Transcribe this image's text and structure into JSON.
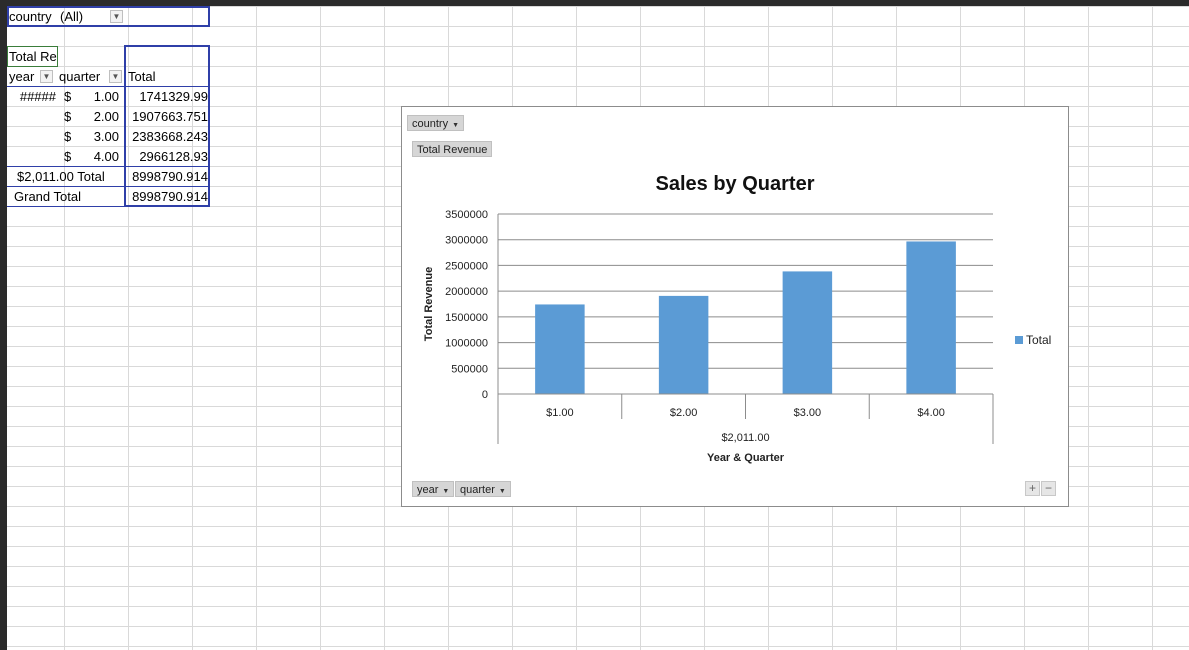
{
  "filter": {
    "field": "country",
    "value": "(All)"
  },
  "pivot": {
    "value_header": "Total Re",
    "row_header_1": "year",
    "row_header_2": "quarter",
    "col_header": "Total",
    "rows": [
      {
        "year": "#####",
        "cur": "$",
        "quarter": "1.00",
        "total": "1741329.99"
      },
      {
        "year": "",
        "cur": "$",
        "quarter": "2.00",
        "total": "1907663.751"
      },
      {
        "year": "",
        "cur": "$",
        "quarter": "3.00",
        "total": "2383668.243"
      },
      {
        "year": "",
        "cur": "$",
        "quarter": "4.00",
        "total": "2966128.93"
      }
    ],
    "subtotal_label": "$2,011.00  Total",
    "subtotal_value": "8998790.914",
    "grand_total_label": "Grand Total",
    "grand_total_value": "8998790.914"
  },
  "chart_buttons": {
    "filter": "country",
    "values": "Total Revenue",
    "axis_1": "year",
    "axis_2": "quarter"
  },
  "chart_data": {
    "type": "bar",
    "title": "Sales by Quarter",
    "xlabel": "Year & Quarter",
    "ylabel": "Total Revenue",
    "categories": [
      "$1.00",
      "$2.00",
      "$3.00",
      "$4.00"
    ],
    "group_label": "$2,011.00",
    "series": [
      {
        "name": "Total",
        "values": [
          1741329.99,
          1907663.751,
          2383668.243,
          2966128.93
        ]
      }
    ],
    "yticks": [
      "0",
      "500000",
      "1000000",
      "1500000",
      "2000000",
      "2500000",
      "3000000",
      "3500000"
    ],
    "ylim": [
      0,
      3500000
    ],
    "legend": "right",
    "grid": true,
    "color": "#5b9bd5"
  }
}
